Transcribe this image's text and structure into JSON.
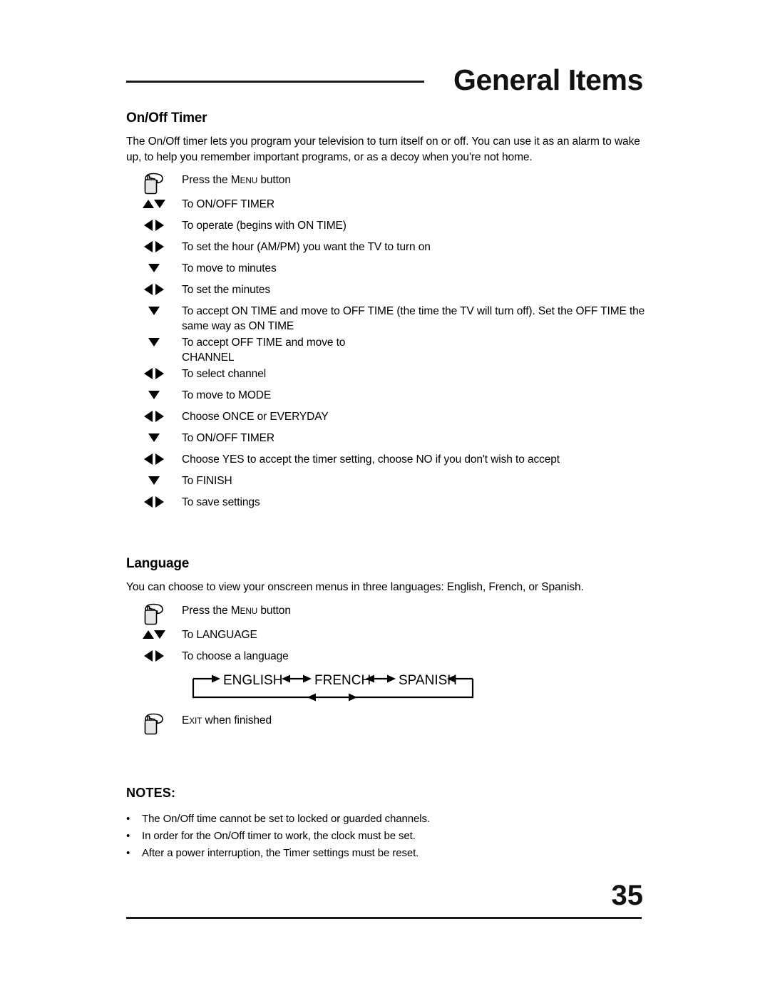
{
  "header": {
    "title": "General Items"
  },
  "sections": {
    "timer": {
      "heading": "On/Off Timer",
      "intro": "The On/Off timer lets you program your television to turn itself on or off. You can use it as an alarm to wake up, to help you remember important programs, or as a decoy when you're not home.",
      "steps": [
        {
          "icon": "press-hand-icon",
          "text_prefix": "Press the ",
          "smallcaps_first": "M",
          "smallcaps_rest": "ENU",
          "text_suffix": " button"
        },
        {
          "icon": "up-down-arrows-icon",
          "text": "To ON/OFF TIMER"
        },
        {
          "icon": "left-right-arrows-icon",
          "text": "To operate (begins with ON TIME)"
        },
        {
          "icon": "left-right-arrows-icon",
          "text": "To set the hour (AM/PM) you want the TV to turn on"
        },
        {
          "icon": "down-arrow-icon",
          "text": "To move to minutes"
        },
        {
          "icon": "left-right-arrows-icon",
          "text": "To set the minutes"
        },
        {
          "icon": "down-arrow-icon",
          "text": "To accept ON TIME and move to OFF TIME (the time the TV will turn off). Set the OFF TIME the same way as ON TIME"
        },
        {
          "icon": "down-arrow-icon",
          "text": "To accept OFF TIME and move to",
          "text_line2": "CHANNEL"
        },
        {
          "icon": "left-right-arrows-icon",
          "text": "To select channel"
        },
        {
          "icon": "down-arrow-icon",
          "text": "To move to MODE"
        },
        {
          "icon": "left-right-arrows-icon",
          "text": "Choose ONCE or EVERYDAY"
        },
        {
          "icon": "down-arrow-icon",
          "text": "To ON/OFF TIMER"
        },
        {
          "icon": "left-right-arrows-icon",
          "text": "Choose YES to accept the timer setting, choose NO if you don't wish to accept"
        },
        {
          "icon": "down-arrow-icon",
          "text": "To FINISH"
        },
        {
          "icon": "left-right-arrows-icon",
          "text": "To save settings"
        }
      ]
    },
    "language": {
      "heading": "Language",
      "intro": "You can choose to view your onscreen menus in three languages: English, French, or Spanish.",
      "steps": [
        {
          "icon": "press-hand-icon",
          "text_prefix": "Press the ",
          "smallcaps_first": "M",
          "smallcaps_rest": "ENU",
          "text_suffix": " button"
        },
        {
          "icon": "up-down-arrows-icon",
          "text": "To LANGUAGE"
        },
        {
          "icon": "left-right-arrows-icon",
          "text": "To choose a language"
        }
      ],
      "cycle": {
        "items": [
          "ENGLISH",
          "FRENCH",
          "SPANISH"
        ]
      },
      "exit_step": {
        "icon": "press-hand-icon",
        "smallcaps_first": "E",
        "smallcaps_rest": "XIT",
        "text_suffix": " when finished"
      }
    },
    "notes": {
      "heading": "NOTES:",
      "bullet": "•",
      "items": [
        "The On/Off time cannot be set to locked or guarded channels.",
        "In order for the On/Off timer to work, the clock must be set.",
        "After a power interruption, the Timer settings must be reset."
      ]
    }
  },
  "footer": {
    "page_number": "35"
  }
}
